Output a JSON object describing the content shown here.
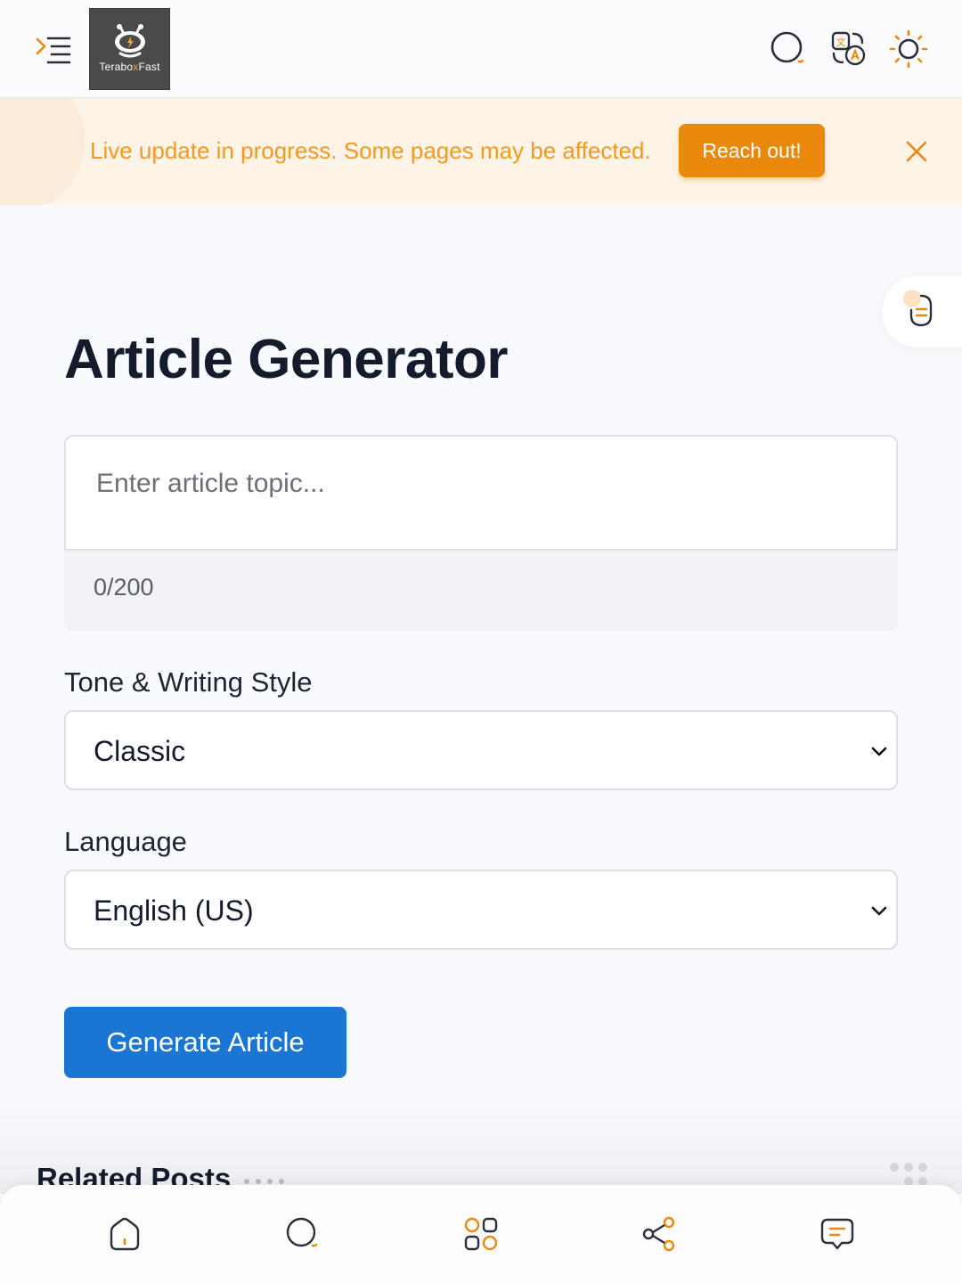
{
  "header": {
    "logo_text_left": "Terabo",
    "logo_text_x": "x",
    "logo_text_right": "Fast",
    "icons": [
      "menu-icon",
      "search-icon",
      "translate-icon",
      "theme-toggle-icon"
    ]
  },
  "banner": {
    "message": "Live update in progress. Some pages may be affected.",
    "button_label": "Reach out!"
  },
  "main": {
    "title": "Article Generator",
    "topic_placeholder": "Enter article topic...",
    "char_counter": "0/200",
    "tone_label": "Tone & Writing Style",
    "tone_value": "Classic",
    "language_label": "Language",
    "language_value": "English (US)",
    "generate_label": "Generate Article"
  },
  "related": {
    "title": "Related Posts"
  },
  "bottom_nav": [
    "home-icon",
    "search-icon",
    "apps-icon",
    "share-icon",
    "chat-icon"
  ],
  "colors": {
    "accent_orange": "#e8890c",
    "banner_text": "#f09a22",
    "primary_blue": "#1b76d3",
    "title": "#141b2d"
  }
}
